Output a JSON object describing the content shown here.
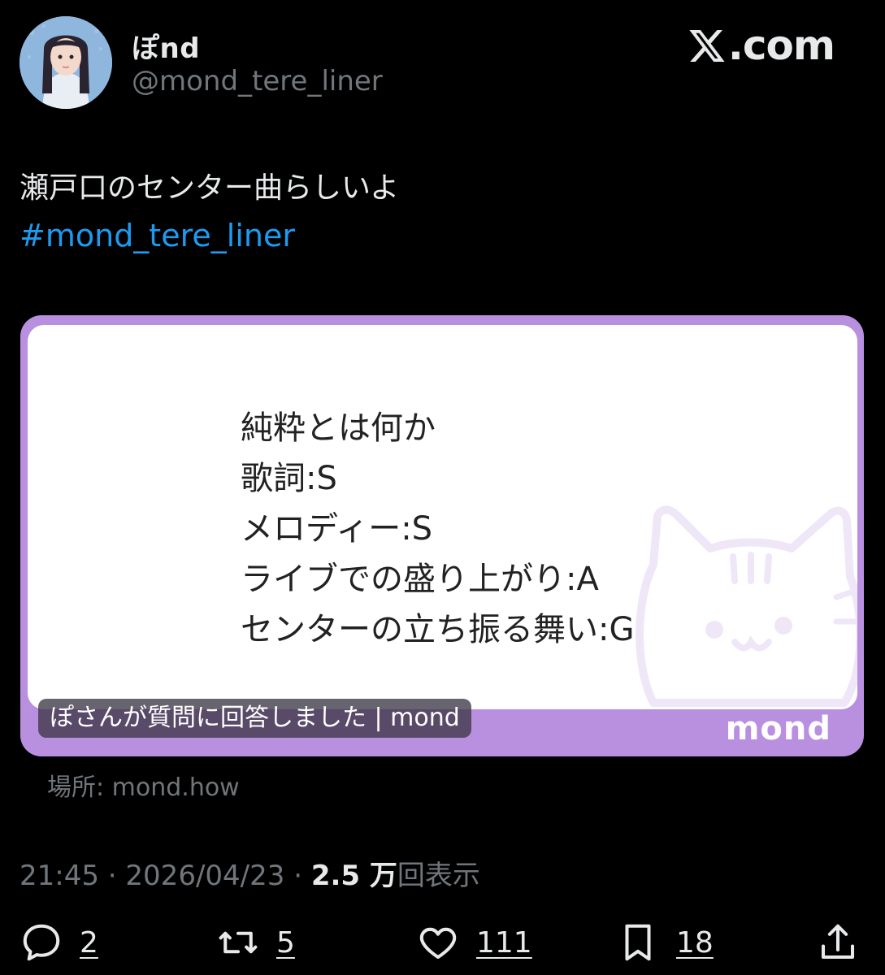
{
  "user": {
    "display_name": "ぽnd",
    "handle": "@mond_tere_liner"
  },
  "site_logo": "com",
  "tweet": {
    "text": "瀬戸口のセンター曲らしいよ",
    "hashtag": "#mond_tere_liner"
  },
  "card": {
    "lines": [
      "純粋とは何か",
      "歌詞:S",
      "メロディー:S",
      "ライブでの盛り上がり:A",
      "センターの立ち振る舞い:G"
    ],
    "caption": "ぽさんが質問に回答しました | mond",
    "brand": "mond",
    "border_color": "#b98fe0"
  },
  "source": "場所: mond.how",
  "meta": {
    "time": "21:45",
    "sep1": " · ",
    "date": "2026/04/23",
    "sep2": " · ",
    "views_number": "2.5 万",
    "views_label": "回表示"
  },
  "actions": {
    "reply_count": "2",
    "retweet_count": "5",
    "like_count": "111",
    "bookmark_count": "18"
  },
  "icons": [
    "reply-icon",
    "retweet-icon",
    "like-icon",
    "bookmark-icon",
    "share-icon",
    "x-logo-icon"
  ]
}
